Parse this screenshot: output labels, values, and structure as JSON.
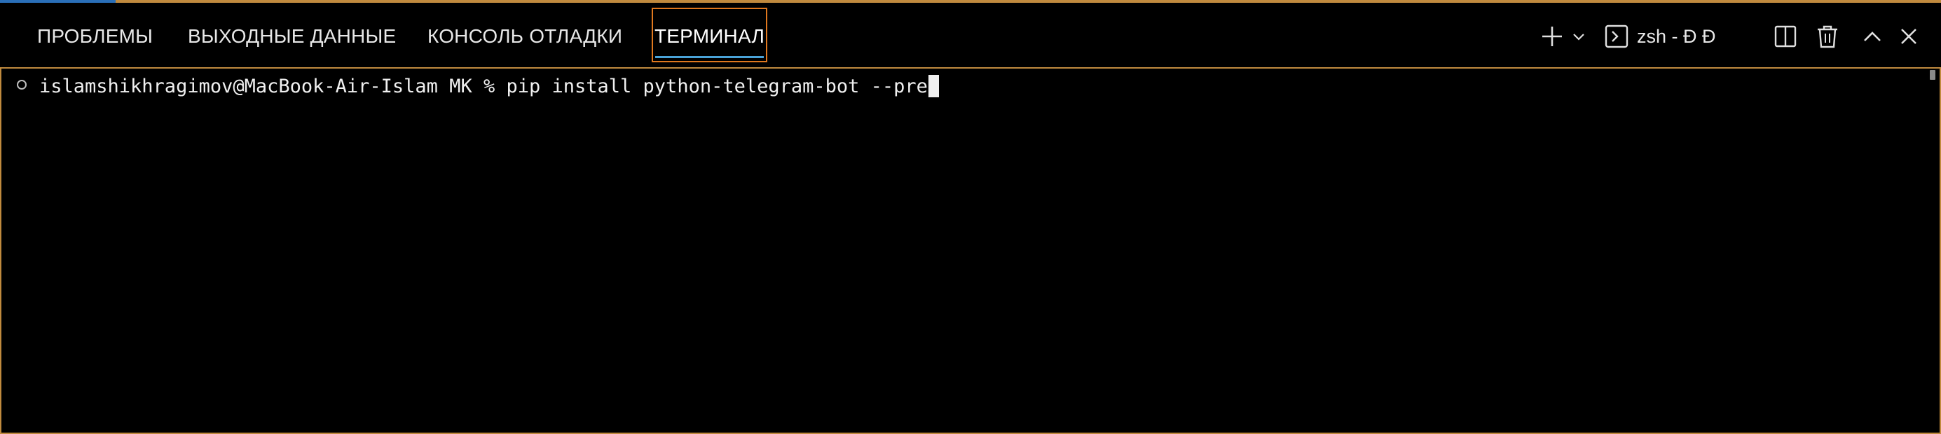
{
  "tabs": {
    "problems": "ПРОБЛЕМЫ",
    "output": "ВЫХОДНЫЕ ДАННЫЕ",
    "debug_console": "КОНСОЛЬ ОТЛАДКИ",
    "terminal": "ТЕРМИНАЛ",
    "active": "terminal"
  },
  "toolbar": {
    "terminal_instance": "zsh - Ð  Ð",
    "icons": [
      "plus-icon",
      "chevron-down-icon",
      "terminal-icon",
      "split-icon",
      "trash-icon",
      "chevron-up-icon",
      "close-icon"
    ]
  },
  "terminal": {
    "prompt": "islamshikhragimov@MacBook-Air-Islam MK % ",
    "command": "pip install python-telegram-bot --pre"
  },
  "colors": {
    "background": "#000000",
    "focus_border": "#c08a3e",
    "active_tab_border": "#e0781e",
    "active_tab_underline": "#4aa3d8",
    "text": "#e8e8e8"
  }
}
